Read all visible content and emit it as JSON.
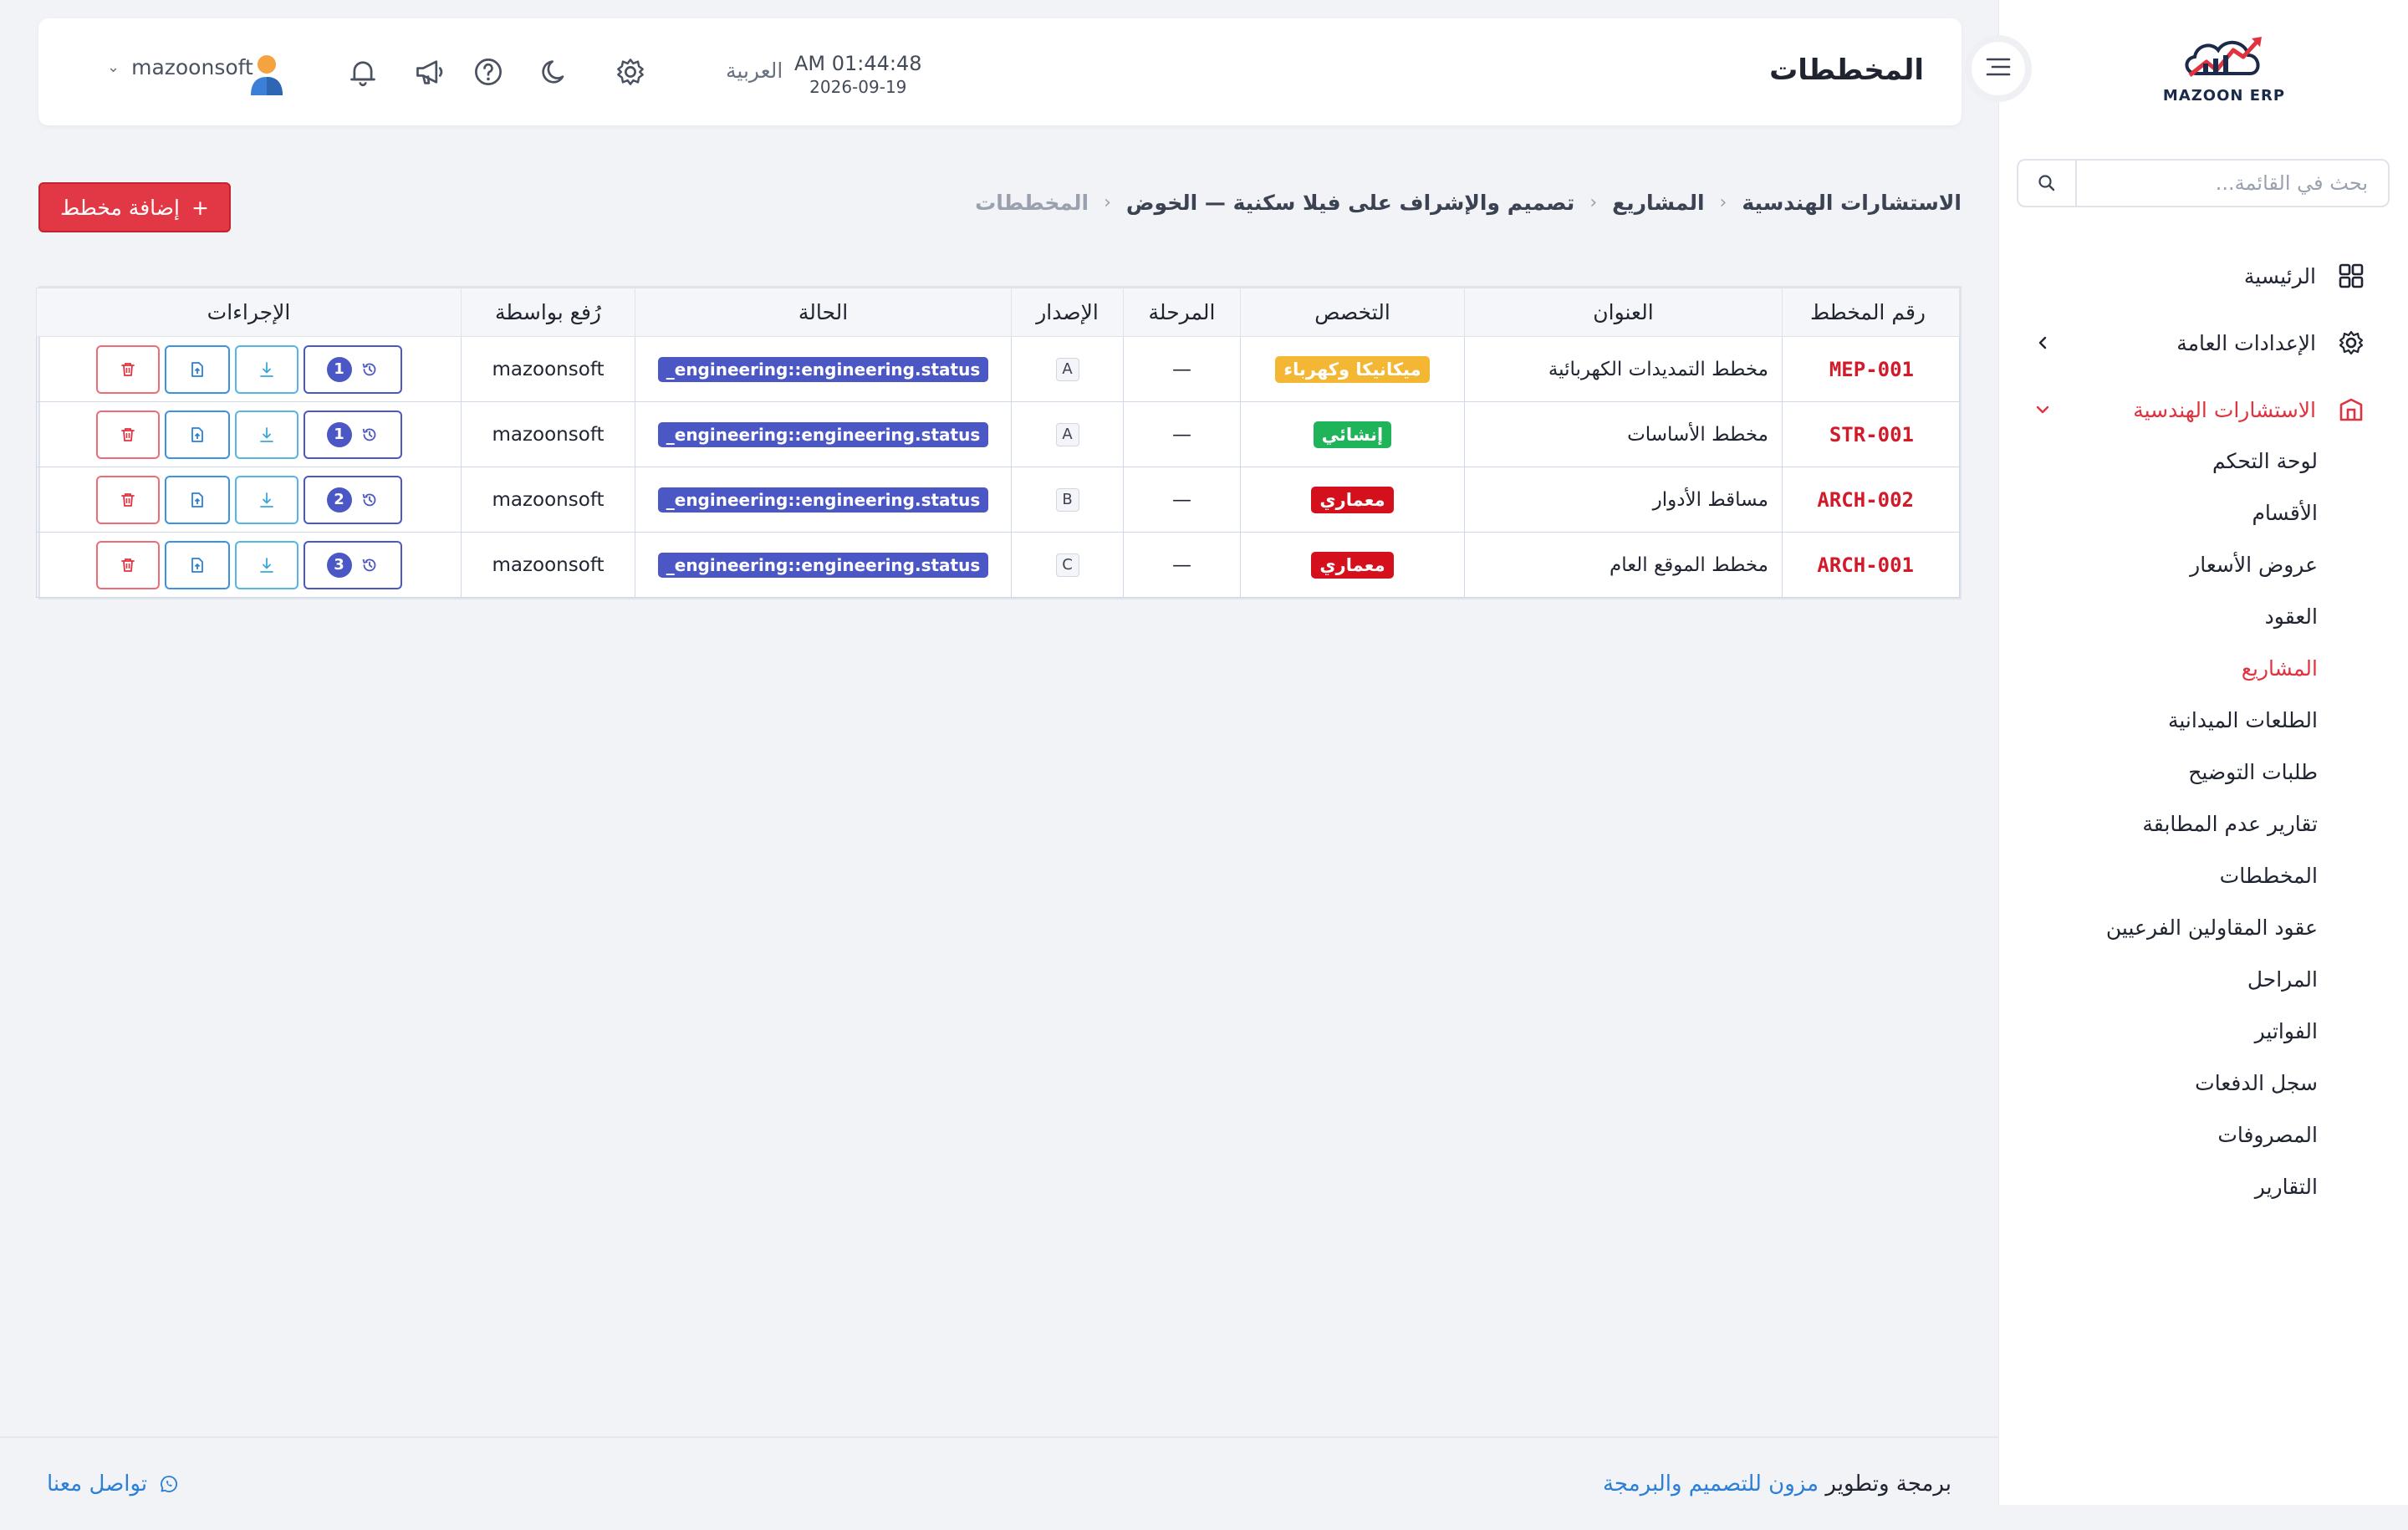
{
  "app": {
    "logo_text": "MAZOON ERP",
    "page_title": "المخططات",
    "clock_time": "AM 01:44:48",
    "clock_date": "2026-09-19",
    "language": "العربية",
    "user_name": "mazoonsoft",
    "accent": "#e0323f"
  },
  "sidebar": {
    "search_placeholder": "بحث في القائمة...",
    "main": [
      {
        "label": "الرئيسية",
        "icon": "grid-icon"
      },
      {
        "label": "الإعدادات العامة",
        "icon": "gear-icon"
      },
      {
        "label": "الاستشارات الهندسية",
        "icon": "building-icon",
        "active": true
      }
    ],
    "sub": [
      {
        "label": "لوحة التحكم"
      },
      {
        "label": "الأقسام"
      },
      {
        "label": "عروض الأسعار"
      },
      {
        "label": "العقود"
      },
      {
        "label": "المشاريع",
        "active": true
      },
      {
        "label": "الطلعات الميدانية"
      },
      {
        "label": "طلبات التوضيح"
      },
      {
        "label": "تقارير عدم المطابقة"
      },
      {
        "label": "المخططات"
      },
      {
        "label": "عقود المقاولين الفرعيين"
      },
      {
        "label": "المراحل"
      },
      {
        "label": "الفواتير"
      },
      {
        "label": "سجل الدفعات"
      },
      {
        "label": "المصروفات"
      },
      {
        "label": "التقارير"
      }
    ]
  },
  "breadcrumb": [
    "الاستشارات الهندسية",
    "المشاريع",
    "تصميم والإشراف على فيلا سكنية — الخوض",
    "المخططات"
  ],
  "add_button": "إضافة مخطط",
  "table": {
    "headers": [
      "رقم المخطط",
      "العنوان",
      "التخصص",
      "المرحلة",
      "الإصدار",
      "الحالة",
      "رُفع بواسطة",
      "الإجراءات"
    ],
    "rows": [
      {
        "number": "MEP-001",
        "title": "مخطط التمديدات الكهربائية",
        "discipline": "ميكانيكا وكهرباء",
        "discipline_color": "#f3b733",
        "phase": "—",
        "version": "A",
        "status": "_engineering::engineering.status",
        "uploaded_by": "mazoonsoft",
        "history_count": "1"
      },
      {
        "number": "STR-001",
        "title": "مخطط الأساسات",
        "discipline": "إنشائي",
        "discipline_color": "#1fb35a",
        "phase": "—",
        "version": "A",
        "status": "_engineering::engineering.status",
        "uploaded_by": "mazoonsoft",
        "history_count": "1"
      },
      {
        "number": "ARCH-002",
        "title": "مساقط الأدوار",
        "discipline": "معماري",
        "discipline_color": "#d3101c",
        "phase": "—",
        "version": "B",
        "status": "_engineering::engineering.status",
        "uploaded_by": "mazoonsoft",
        "history_count": "2"
      },
      {
        "number": "ARCH-001",
        "title": "مخطط الموقع العام",
        "discipline": "معماري",
        "discipline_color": "#d3101c",
        "phase": "—",
        "version": "C",
        "status": "_engineering::engineering.status",
        "uploaded_by": "mazoonsoft",
        "history_count": "3"
      }
    ]
  },
  "footer": {
    "credit_prefix": "برمجة وتطوير",
    "credit_brand": "مزون للتصميم والبرمجة",
    "contact": "تواصل معنا"
  }
}
